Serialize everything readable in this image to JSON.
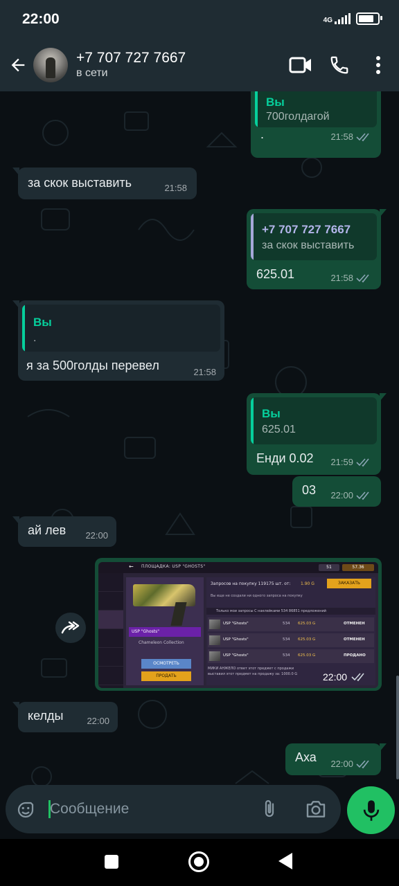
{
  "status_bar": {
    "time": "22:00",
    "network": "4G"
  },
  "header": {
    "contact_name": "+7 707 727 7667",
    "contact_status": "в сети",
    "icons": [
      "back-arrow-icon",
      "video-call-icon",
      "phone-icon",
      "more-vert-icon"
    ]
  },
  "messages": [
    {
      "dir": "out",
      "quote_name": "Вы",
      "quote_text": "700голдагой",
      "text": ".",
      "time": "21:58",
      "read": true
    },
    {
      "dir": "in",
      "text": "за скок выставить",
      "time": "21:58"
    },
    {
      "dir": "out",
      "quote_name": "+7 707 727 7667",
      "quote_text": "за скок выставить",
      "text": "625.01",
      "time": "21:58",
      "read": true
    },
    {
      "dir": "in",
      "quote_name": "Вы",
      "quote_text": ".",
      "text": "я за 500голды перевел",
      "time": "21:58"
    },
    {
      "dir": "out",
      "quote_name": "Вы",
      "quote_text": "625.01",
      "text": "Енди 0.02",
      "time": "21:59",
      "read": true
    },
    {
      "dir": "out",
      "text": "03",
      "time": "22:00",
      "read": true
    },
    {
      "dir": "in",
      "text": "ай лев",
      "time": "22:00"
    },
    {
      "dir": "out",
      "type": "image",
      "time": "22:00",
      "read": true
    },
    {
      "dir": "in",
      "text": "келды",
      "time": "22:00"
    },
    {
      "dir": "out",
      "text": "Аха",
      "time": "22:00",
      "read": true
    }
  ],
  "image_message": {
    "screen_title": "ПЛОЩАДКА: USP \"GHOSTS\"",
    "coins_silver": "51",
    "coins_gold": "57.36",
    "item_name": "USP \"Ghosts\"",
    "collection": "Chameleon Collection",
    "btn_inspect": "ОСМОТРЕТЬ",
    "btn_sell": "ПРОДАТЬ",
    "purchase_requests": "Запросов на покупку 119175 шт. от:",
    "purchase_price": "1.90 G",
    "order_btn": "ЗАКАЗАТЬ",
    "note": "Вы еще не создали ни одного запроса на покупку",
    "tabs_text": "Только мои запросы     С наклейками      534          86851 предложений",
    "rows": [
      {
        "name": "USP \"Ghosts\"",
        "qty": "534",
        "price": "625.03 G",
        "status": "ОТМЕНЕН",
        "status_color": "#f3f3f3"
      },
      {
        "name": "USP \"Ghosts\"",
        "qty": "534",
        "price": "625.03 G",
        "status": "ОТМЕНЕН",
        "status_color": "#f3f3f3"
      },
      {
        "name": "USP \"Ghosts\"",
        "qty": "534",
        "price": "625.03 G",
        "status": "ПРОДАНО",
        "status_color": "#f3f3f3"
      }
    ],
    "footer_line1": "МИКИ АНЖЕЛО ответ этот предмет с продажи",
    "footer_line2": "выставил этот предмет на продажу за: 1000.0 G"
  },
  "composer": {
    "placeholder": "Сообщение",
    "icons": [
      "emoji-icon",
      "attach-icon",
      "camera-icon",
      "mic-icon"
    ]
  },
  "colors": {
    "incoming_bubble": "#1f2c33",
    "outgoing_bubble": "#144d37",
    "accent_green": "#21c063",
    "quote_you": "#06cf9c",
    "quote_contact": "#a5b337"
  }
}
